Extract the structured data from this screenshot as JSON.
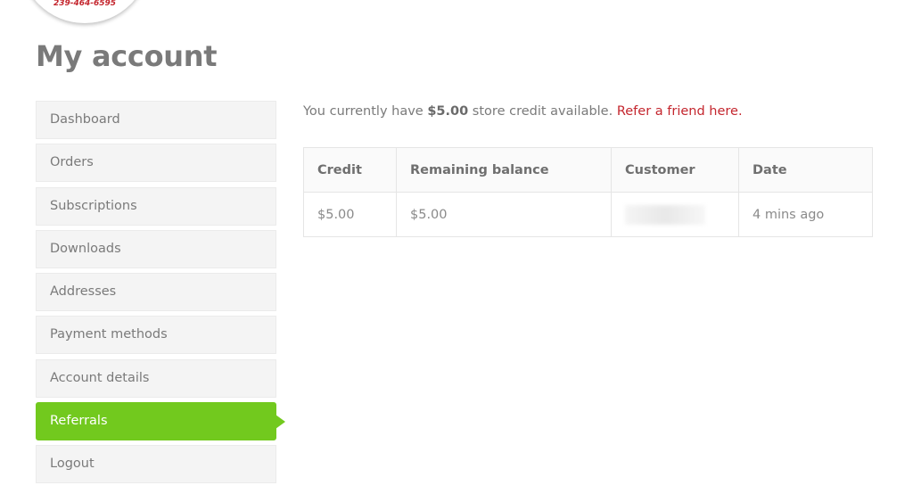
{
  "logo": {
    "phone": "239-464-6595"
  },
  "page_title": "My account",
  "nav": {
    "items": [
      {
        "label": "Dashboard"
      },
      {
        "label": "Orders"
      },
      {
        "label": "Subscriptions"
      },
      {
        "label": "Downloads"
      },
      {
        "label": "Addresses"
      },
      {
        "label": "Payment methods"
      },
      {
        "label": "Account details"
      },
      {
        "label": "Referrals",
        "active": true
      },
      {
        "label": "Logout"
      }
    ]
  },
  "credit_message": {
    "prefix": "You currently have ",
    "amount": "$5.00",
    "suffix": " store credit available. ",
    "link": "Refer a friend here."
  },
  "table": {
    "headers": [
      "Credit",
      "Remaining balance",
      "Customer",
      "Date"
    ],
    "rows": [
      {
        "credit": "$5.00",
        "remaining": "$5.00",
        "customer": "",
        "date": "4 mins ago"
      }
    ]
  },
  "colors": {
    "accent": "#72c91e",
    "link": "#c4262e"
  }
}
